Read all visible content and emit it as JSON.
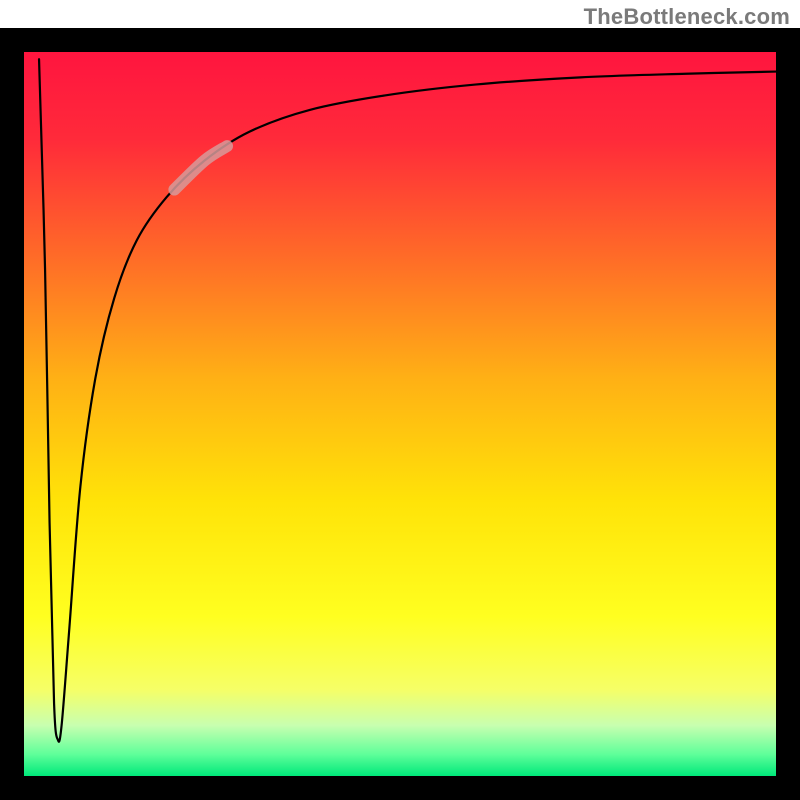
{
  "watermark": "TheBottleneck.com",
  "frame_color": "#000000",
  "gradient_stops": [
    {
      "offset": 0.0,
      "color": "#ff153f"
    },
    {
      "offset": 0.12,
      "color": "#ff2a3a"
    },
    {
      "offset": 0.28,
      "color": "#ff6a28"
    },
    {
      "offset": 0.45,
      "color": "#ffb015"
    },
    {
      "offset": 0.62,
      "color": "#ffe308"
    },
    {
      "offset": 0.78,
      "color": "#ffff20"
    },
    {
      "offset": 0.88,
      "color": "#f6ff66"
    },
    {
      "offset": 0.93,
      "color": "#c8ffb0"
    },
    {
      "offset": 0.97,
      "color": "#5fff9a"
    },
    {
      "offset": 1.0,
      "color": "#00e87a"
    }
  ],
  "highlight": {
    "color": "#d79a9a",
    "opacity": 0.85,
    "width": 12,
    "x_from": 0.2,
    "x_to": 0.27
  },
  "chart_data": {
    "type": "line",
    "title": "",
    "xlabel": "",
    "ylabel": "",
    "xlim": [
      0,
      1
    ],
    "ylim": [
      0,
      100
    ],
    "grid": false,
    "legend": false,
    "annotations": [
      "TheBottleneck.com"
    ],
    "series": [
      {
        "name": "bottleneck-curve",
        "comment": "y read as percent of plot height from bottom (0=bottom,100=top). x normalized 0..1 across width. Values estimated from pixels; curve drops sharply to ~5 near x≈0.04 then asymptotically rises toward ~97.",
        "points": [
          {
            "x": 0.02,
            "y": 99
          },
          {
            "x": 0.028,
            "y": 70
          },
          {
            "x": 0.034,
            "y": 35
          },
          {
            "x": 0.04,
            "y": 10
          },
          {
            "x": 0.045,
            "y": 5
          },
          {
            "x": 0.05,
            "y": 7
          },
          {
            "x": 0.06,
            "y": 20
          },
          {
            "x": 0.075,
            "y": 40
          },
          {
            "x": 0.095,
            "y": 55
          },
          {
            "x": 0.12,
            "y": 66
          },
          {
            "x": 0.15,
            "y": 74
          },
          {
            "x": 0.19,
            "y": 80
          },
          {
            "x": 0.24,
            "y": 85
          },
          {
            "x": 0.3,
            "y": 89
          },
          {
            "x": 0.38,
            "y": 92
          },
          {
            "x": 0.48,
            "y": 94
          },
          {
            "x": 0.6,
            "y": 95.5
          },
          {
            "x": 0.74,
            "y": 96.5
          },
          {
            "x": 0.88,
            "y": 97
          },
          {
            "x": 1.0,
            "y": 97.3
          }
        ]
      }
    ]
  }
}
